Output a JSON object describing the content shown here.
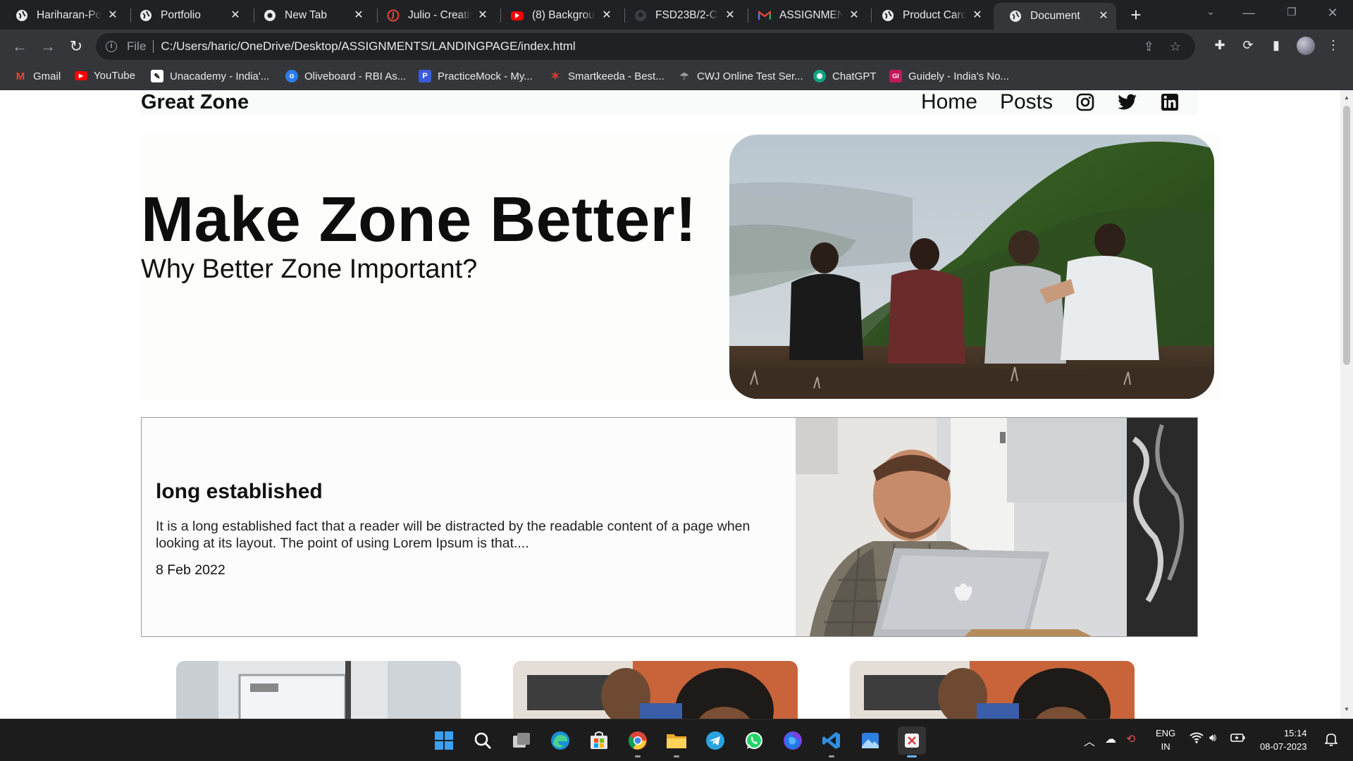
{
  "browser": {
    "tabs": [
      {
        "title": "Hariharan-Portfolio",
        "icon": "globe-icon"
      },
      {
        "title": "Portfolio",
        "icon": "globe-icon"
      },
      {
        "title": "New Tab",
        "icon": "chrome-icon"
      },
      {
        "title": "Julio - Creative",
        "icon": "julio-icon"
      },
      {
        "title": "(8) Background",
        "icon": "youtube-icon"
      },
      {
        "title": "FSD23B/2-CSS",
        "icon": "github-icon"
      },
      {
        "title": "ASSIGNMENTS",
        "icon": "gmail-icon"
      },
      {
        "title": "Product Card",
        "icon": "globe-icon"
      },
      {
        "title": "Document",
        "icon": "globe-icon",
        "active": true
      }
    ],
    "address": {
      "scheme": "File",
      "url": "C:/Users/haric/OneDrive/Desktop/ASSIGNMENTS/LANDINGPAGE/index.html"
    },
    "bookmarks": [
      {
        "label": "Gmail",
        "icon": "gmail-icon",
        "color": "#ea4335"
      },
      {
        "label": "YouTube",
        "icon": "youtube-icon",
        "color": "#ff0000"
      },
      {
        "label": "Unacademy - India'...",
        "icon": "unacademy-icon",
        "color": "#ffffff"
      },
      {
        "label": "Oliveboard - RBI As...",
        "icon": "oliveboard-icon",
        "color": "#2b7de9"
      },
      {
        "label": "PracticeMock - My...",
        "icon": "practicemock-icon",
        "color": "#3b5bdb"
      },
      {
        "label": "Smartkeeda - Best...",
        "icon": "smartkeeda-icon",
        "color": "#e53935"
      },
      {
        "label": "CWJ Online Test Ser...",
        "icon": "cwj-icon",
        "color": "#777777"
      },
      {
        "label": "ChatGPT",
        "icon": "chatgpt-icon",
        "color": "#10a37f"
      },
      {
        "label": "Guidely - India's No...",
        "icon": "guidely-icon",
        "color": "#c2185b"
      }
    ]
  },
  "site": {
    "brand": "Great Zone",
    "nav": {
      "home": "Home",
      "posts": "Posts"
    },
    "hero": {
      "title": "Make Zone Better!",
      "subtitle": "Why Better Zone Important?"
    },
    "feature": {
      "heading": "long established",
      "body": "It is a long established fact that a reader will be distracted by the readable content of a page when looking at its layout. The point of using Lorem Ipsum is that....",
      "date": "8 Feb 2022"
    }
  },
  "taskbar": {
    "language": {
      "line1": "ENG",
      "line2": "IN"
    },
    "time": "15:14",
    "date": "08-07-2023"
  }
}
